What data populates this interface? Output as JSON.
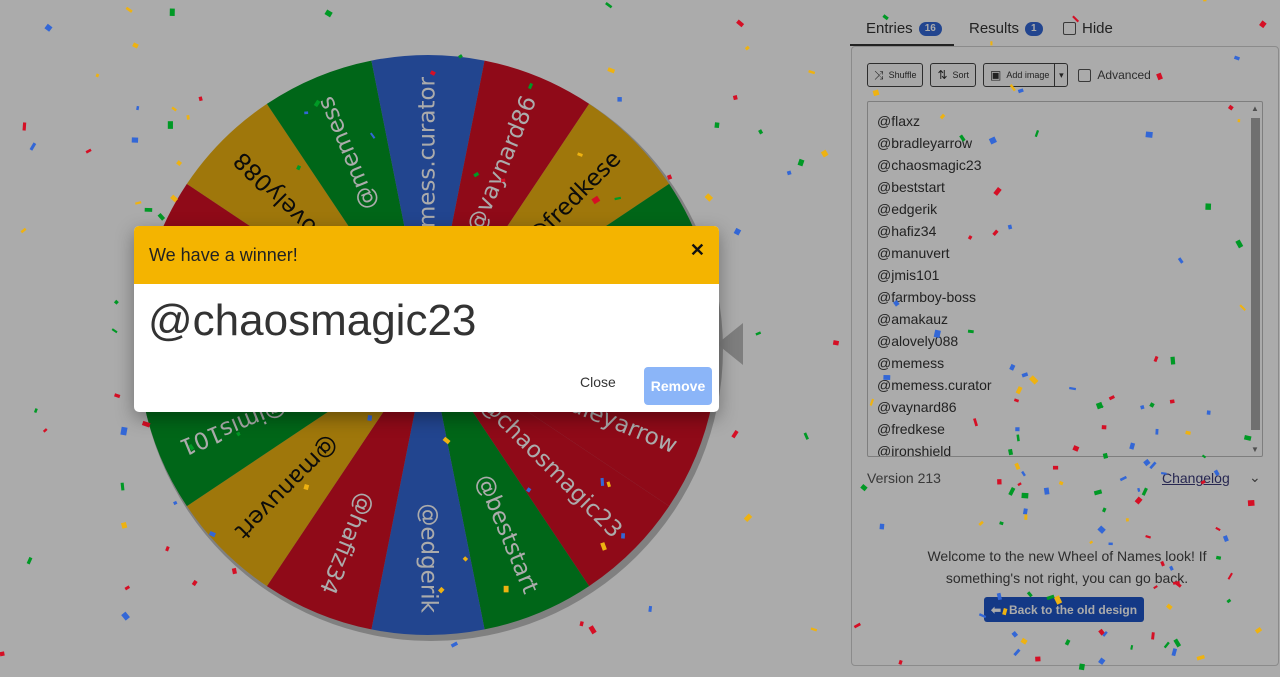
{
  "wheel": {
    "segments": [
      {
        "label": "@flaxz",
        "color": "#3367d6"
      },
      {
        "label": "@bradleyarrow",
        "color": "#d50f25"
      },
      {
        "label": "@chaosmagic23",
        "color": "#d50f25"
      },
      {
        "label": "@beststart",
        "color": "#009925"
      },
      {
        "label": "@edgerik",
        "color": "#3367d6"
      },
      {
        "label": "@hafiz34",
        "color": "#d50f25"
      },
      {
        "label": "@manuvert",
        "color": "#eeb211"
      },
      {
        "label": "@jmis101",
        "color": "#009925"
      },
      {
        "label": "@farmboy-boss",
        "color": "#3367d6"
      },
      {
        "label": "@amakauz",
        "color": "#d50f25"
      },
      {
        "label": "@alovely088",
        "color": "#eeb211"
      },
      {
        "label": "@memess",
        "color": "#009925"
      },
      {
        "label": "@memess.curator",
        "color": "#3367d6"
      },
      {
        "label": "@vaynard86",
        "color": "#d50f25"
      },
      {
        "label": "@fredkese",
        "color": "#eeb211"
      },
      {
        "label": "@ironshield",
        "color": "#009925"
      }
    ]
  },
  "tabs": {
    "entries_label": "Entries",
    "entries_count": "16",
    "results_label": "Results",
    "results_count": "1",
    "hide_label": "Hide"
  },
  "toolbar": {
    "shuffle_label": "Shuffle",
    "sort_label": "Sort",
    "add_image_label": "Add image",
    "advanced_label": "Advanced"
  },
  "entries": [
    "@flaxz",
    "@bradleyarrow",
    "@chaosmagic23",
    "@beststart",
    "@edgerik",
    "@hafiz34",
    "@manuvert",
    "@jmis101",
    "@farmboy-boss",
    "@amakauz",
    "@alovely088",
    "@memess",
    "@memess.curator",
    "@vaynard86",
    "@fredkese",
    "@ironshield"
  ],
  "footer": {
    "version": "Version 213",
    "changelog": "Changelog",
    "welcome": "Welcome to the new Wheel of Names look! If something's not right, you can go back.",
    "back_button": "Back to the old design"
  },
  "modal": {
    "title": "We have a winner!",
    "winner": "@chaosmagic23",
    "close_label": "Close",
    "remove_label": "Remove"
  },
  "colors": {
    "header_yellow": "#f4b400",
    "badge_blue": "#3367d6",
    "remove_button": "#8bb5f8",
    "back_button": "#1e56c8"
  }
}
